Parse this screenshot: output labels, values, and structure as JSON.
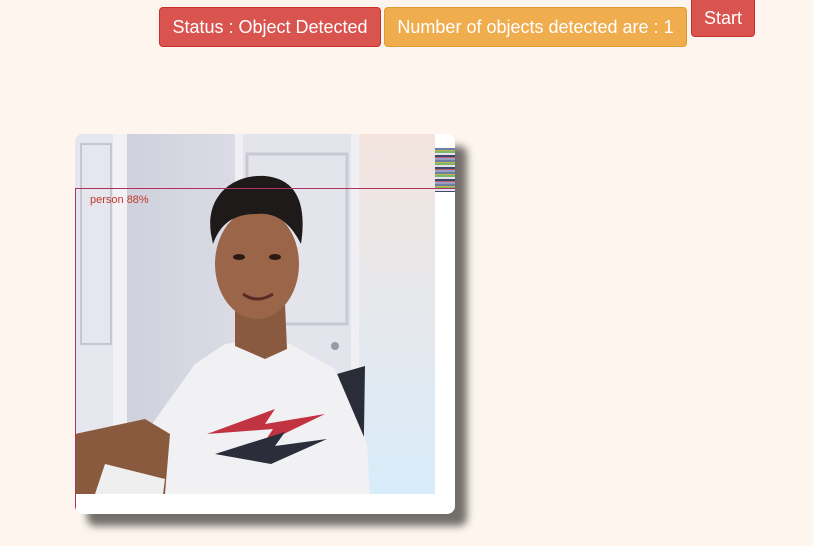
{
  "header": {
    "status_label": "Status : Object Detected",
    "count_label": "Number of objects detected are : 1",
    "start_label": "Start"
  },
  "detection": {
    "label": "person 88%"
  },
  "colors": {
    "status": "#d9534f",
    "count": "#f0ad4e",
    "start": "#d9534f",
    "detection_box": "#b03060",
    "page_background": "#fdf5ee"
  }
}
